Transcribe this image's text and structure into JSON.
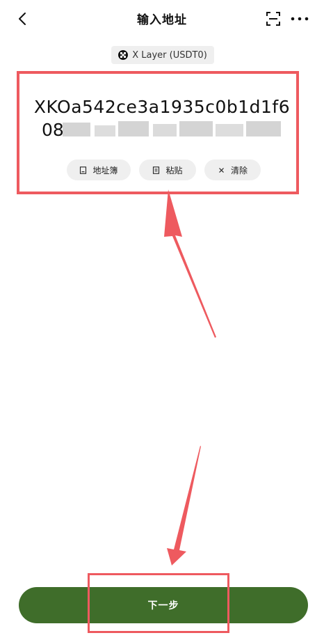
{
  "header": {
    "title": "输入地址",
    "back_icon": "chevron-left-icon",
    "scan_icon": "scan-icon",
    "more_icon": "more-horizontal-icon"
  },
  "network": {
    "label": "X Layer (USDT0)",
    "icon": "x-layer-icon"
  },
  "address": {
    "line1": "XKOa542ce3a1935c0b1d1f6",
    "line2_visible": "08",
    "blurred": true
  },
  "actions": [
    {
      "label": "地址簿",
      "icon": "address-book-icon"
    },
    {
      "label": "粘贴",
      "icon": "paste-icon"
    },
    {
      "label": "清除",
      "icon": "close-icon"
    }
  ],
  "next_button": {
    "label": "下一步"
  },
  "colors": {
    "accent": "#3f6d2a",
    "annotation": "#ee5a5f",
    "chip_bg": "#efefef"
  }
}
